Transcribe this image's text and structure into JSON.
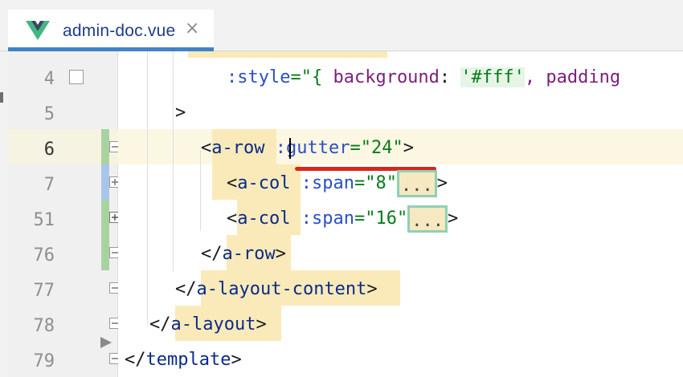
{
  "tab": {
    "title": "admin-doc.vue",
    "close": "×",
    "vue_logo_color": "#41b883",
    "vue_logo_dark": "#35495e"
  },
  "gutter": {
    "line_numbers": [
      "4",
      "5",
      "6",
      "7",
      "51",
      "76",
      "77",
      "78",
      "79"
    ]
  },
  "code": {
    "line4": {
      "attr": ":style",
      "eq": "=\"{ ",
      "prop": "background",
      "colon": ": ",
      "val": "'#fff'",
      "rest": ", padding"
    },
    "line5": {
      "text": ">"
    },
    "line6": {
      "lt": "<",
      "tag": "a-row",
      "sp": " ",
      "attr": ":gutter",
      "eq": "=",
      "val": "\"24\"",
      "gt": ">"
    },
    "line7": {
      "lt": "<",
      "tag": "a-col",
      "sp": " ",
      "attr": ":span",
      "eq": "=",
      "val": "\"8\"",
      "fold": "...",
      "gt": ">"
    },
    "line51": {
      "lt": "<",
      "tag": "a-col",
      "sp": " ",
      "attr": ":span",
      "eq": "=",
      "val": "\"16\"",
      "fold": "...",
      "gt": ">"
    },
    "line76": {
      "lt": "</",
      "tag": "a-row",
      "gt": ">"
    },
    "line77": {
      "lt": "</",
      "tag": "a-layout-content",
      "gt": ">"
    },
    "line78": {
      "lt": "</",
      "tag": "a-layout",
      "gt": ">"
    },
    "line79": {
      "lt": "</",
      "tag": "template",
      "gt": ">"
    }
  },
  "colors": {
    "tag_highlight": "#faeab9",
    "current_line": "#fbf7e3",
    "annotation_red": "#d9261c",
    "change_green": "#a8d3a0",
    "change_blue": "#a9c6e8"
  }
}
